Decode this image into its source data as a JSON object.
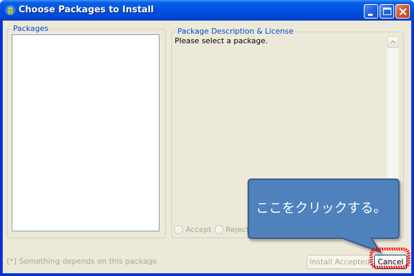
{
  "window": {
    "title": "Choose Packages to Install",
    "app_icon": "android-icon",
    "buttons": [
      "minimize-icon",
      "maximize-icon",
      "close-icon"
    ]
  },
  "packages": {
    "label": "Packages",
    "items": []
  },
  "description": {
    "label": "Package Description & License",
    "text": "Please select a package."
  },
  "options": {
    "accept_label": "Accept",
    "reject_label": "Reject"
  },
  "footer": {
    "note": "[*] Something depends on this package"
  },
  "actions": {
    "install_label": "Install Accepted",
    "cancel_label": "Cancel"
  },
  "annotation": {
    "callout_text": "ここをクリックする。",
    "callout_color": "#4f81bd",
    "highlight_color": "#ff0000"
  },
  "colors": {
    "titlebar": "#0054e3",
    "client_bg": "#ece9d8",
    "group_label": "#0046d5"
  }
}
